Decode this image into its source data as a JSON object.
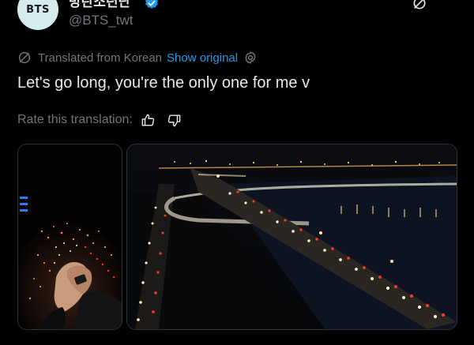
{
  "author": {
    "avatar_text": "BTS",
    "display_name": "방탄소년단",
    "handle": "@BTS_twt"
  },
  "translation": {
    "label": "Translated from Korean",
    "show_original": "Show original",
    "rate_label": "Rate this translation:"
  },
  "tweet": {
    "text": "Let's go long, you're the only one for me v"
  },
  "colors": {
    "background": "#000000",
    "text": "#e7e9ea",
    "muted": "#71767b",
    "link": "#1d9bf0"
  },
  "icons": [
    "verified-badge-icon",
    "grok-icon",
    "more-icon",
    "translate-globe-icon",
    "settings-icon",
    "thumbs-up-icon",
    "thumbs-down-icon"
  ]
}
